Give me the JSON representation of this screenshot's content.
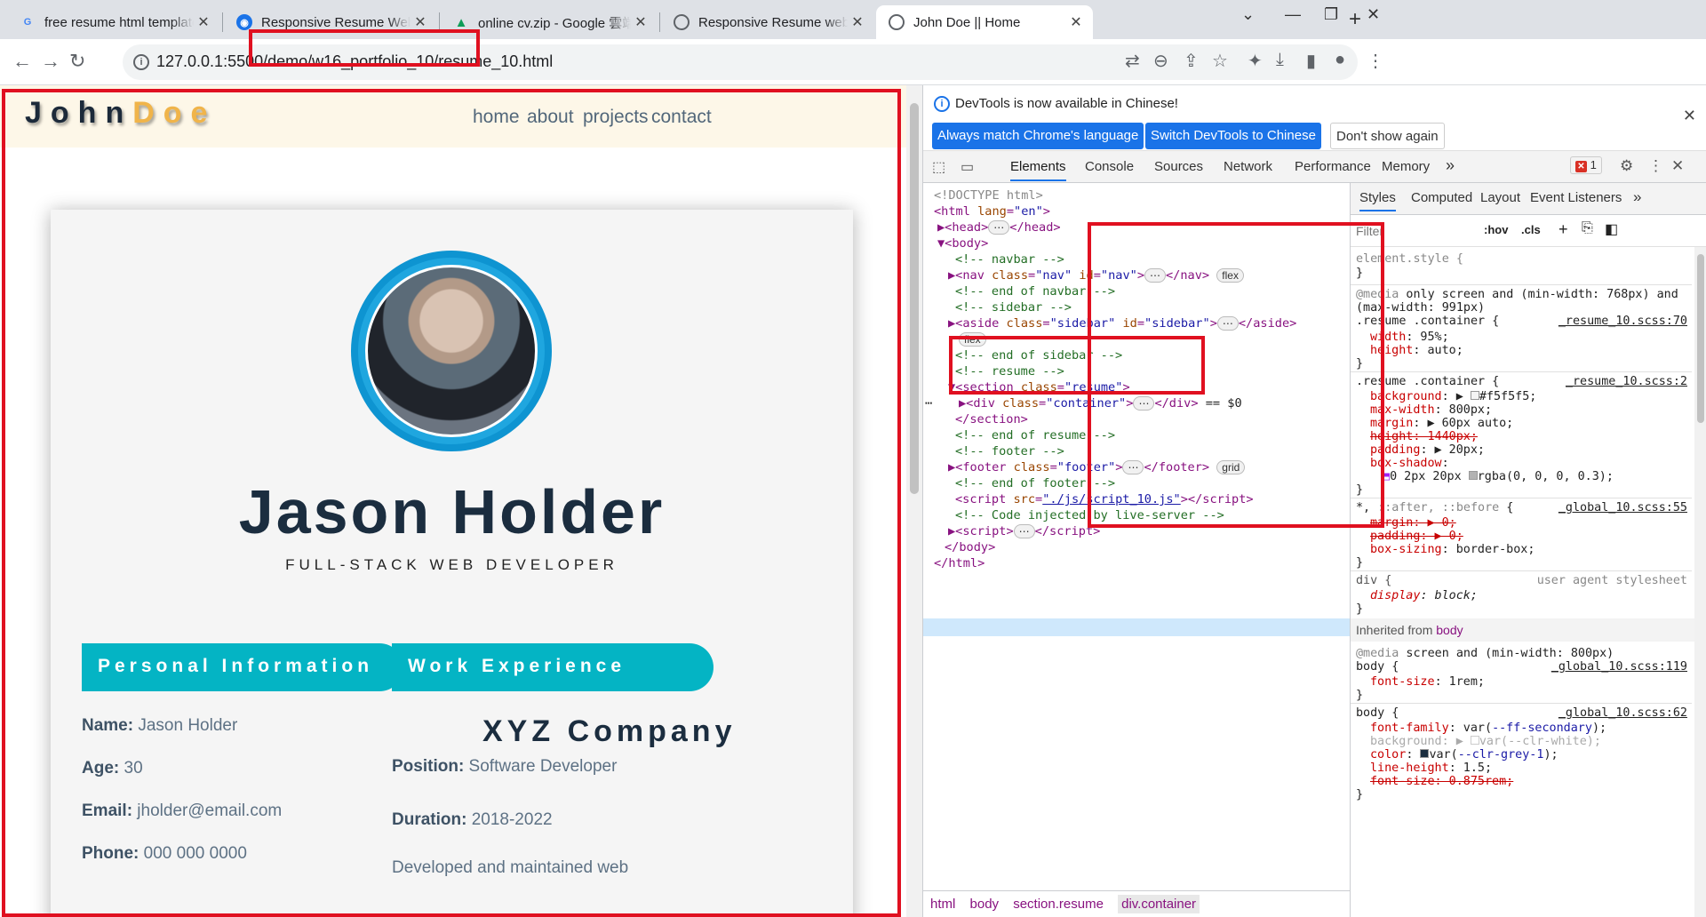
{
  "browser": {
    "tabs": [
      {
        "label": "free resume html template - Go",
        "icon": "google-icon"
      },
      {
        "label": "Responsive Resume Website us",
        "icon": "site-icon"
      },
      {
        "label": "online cv.zip - Google 雲端硬碟",
        "icon": "google-drive-icon"
      },
      {
        "label": "Responsive Resume website htm",
        "icon": "globe-icon"
      },
      {
        "label": "John Doe || Home",
        "icon": "globe-icon"
      }
    ],
    "url_host": "127.0.0.1:5500/demo",
    "url_path": "/w16_portfolio_10/resume_10.html"
  },
  "site": {
    "logo_first": "John",
    "logo_last": "Doe",
    "nav": [
      "home",
      "about",
      "projects",
      "contact"
    ],
    "name": "Jason Holder",
    "title": "FULL-STACK WEB DEVELOPER",
    "personal_heading": "Personal Information",
    "work_heading": "Work Experience",
    "personal": [
      {
        "label": "Name:",
        "value": " Jason Holder"
      },
      {
        "label": "Age:",
        "value": " 30"
      },
      {
        "label": "Email:",
        "value": " jholder@email.com"
      },
      {
        "label": "Phone:",
        "value": " 000 000 0000"
      }
    ],
    "company": "XYZ Company",
    "work": [
      {
        "label": "Position:",
        "value": " Software Developer"
      },
      {
        "label": "Duration:",
        "value": " 2018-2022"
      }
    ],
    "work_desc": "Developed and maintained web"
  },
  "devtools": {
    "banner_text": "DevTools is now available in Chinese!",
    "btn_match": "Always match Chrome's language",
    "btn_switch": "Switch DevTools to Chinese",
    "btn_dont": "Don't show again",
    "tabs": [
      "Elements",
      "Console",
      "Sources",
      "Network",
      "Performance",
      "Memory"
    ],
    "error_count": "1",
    "breadcrumbs": [
      "html",
      "body",
      "section.resume",
      "div.container"
    ],
    "styles_tabs": [
      "Styles",
      "Computed",
      "Layout",
      "Event Listeners"
    ],
    "filter_placeholder": "Filter",
    "hov": ":hov",
    "cls": ".cls",
    "inherited_label": "Inherited from",
    "inherited_from": "body"
  }
}
